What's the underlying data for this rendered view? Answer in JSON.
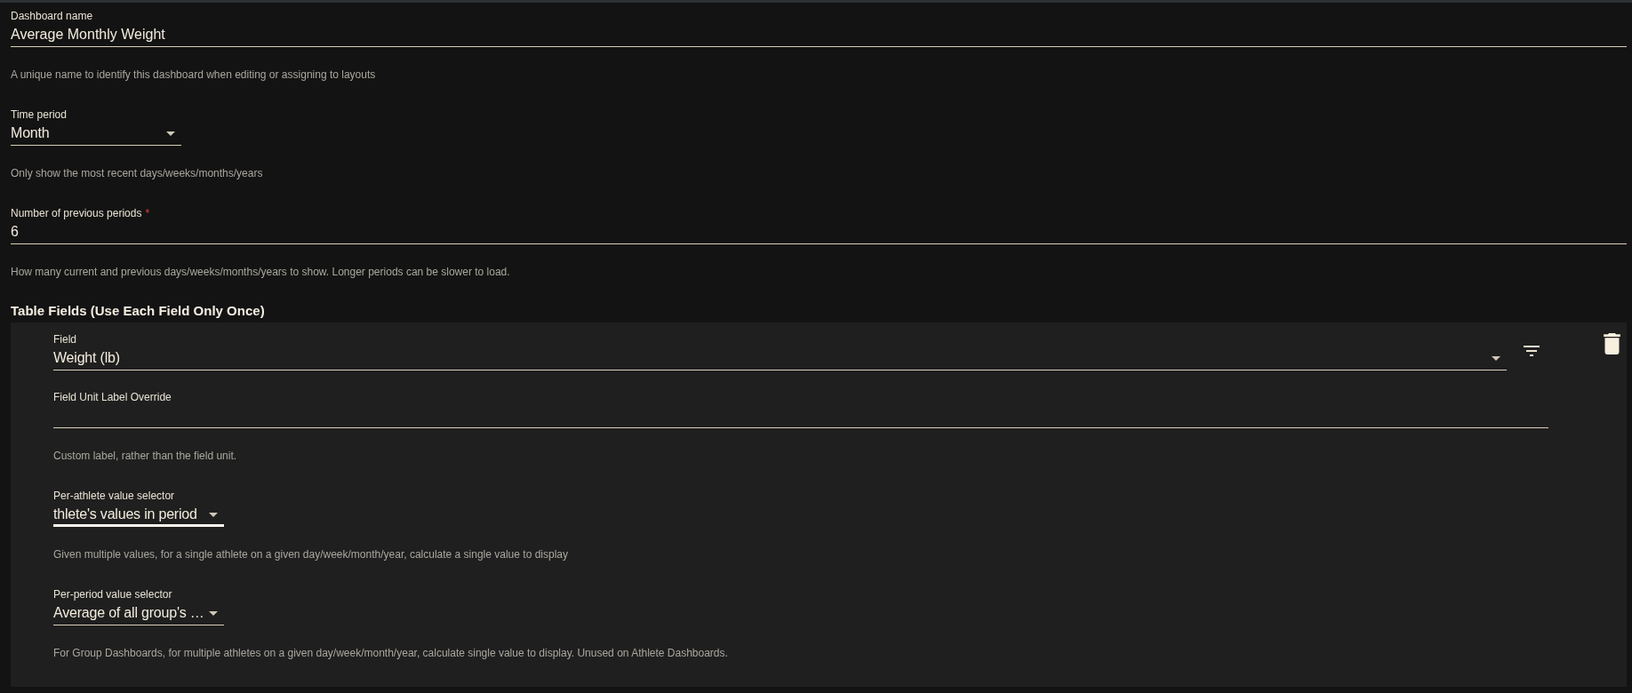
{
  "form_fields": [
    {
      "kind": "text",
      "label": "Dashboard name",
      "value": "Average Monthly Weight",
      "helper": "A unique name to identify this dashboard when editing or assigning to layouts",
      "focused": false
    },
    {
      "kind": "select",
      "label": "Time period",
      "value": "Month",
      "helper": "Only show the most recent days/weeks/months/years",
      "focused": false
    },
    {
      "kind": "text",
      "label": "Number of previous periods",
      "required_mark": "*",
      "value": "6",
      "helper": "How many current and previous days/weeks/months/years to show. Longer periods can be slower to load.",
      "focused": false
    }
  ],
  "table_fields": {
    "title": "Table Fields (Use Each Field Only Once)",
    "items": [
      {
        "inputs": [
          {
            "kind": "field-select",
            "label": "Field",
            "value": "Weight (lb)",
            "focused": false
          },
          {
            "kind": "text",
            "label": "Field Unit Label Override",
            "helper": "Custom label, rather than the field unit.",
            "focused": false
          },
          {
            "kind": "select",
            "label": "Per-athlete value selector",
            "value": "thlete's values in period",
            "helper": "Given multiple values, for a single athlete on a given day/week/month/year, calculate a single value to display",
            "focused": true
          },
          {
            "kind": "select",
            "label": "Per-period value selector",
            "value": "Average of all group's …",
            "helper": "For Group Dashboards, for multiple athletes on a given day/week/month/year, calculate single value to display. Unused on Athlete Dashboards.",
            "focused": false
          }
        ]
      }
    ]
  }
}
